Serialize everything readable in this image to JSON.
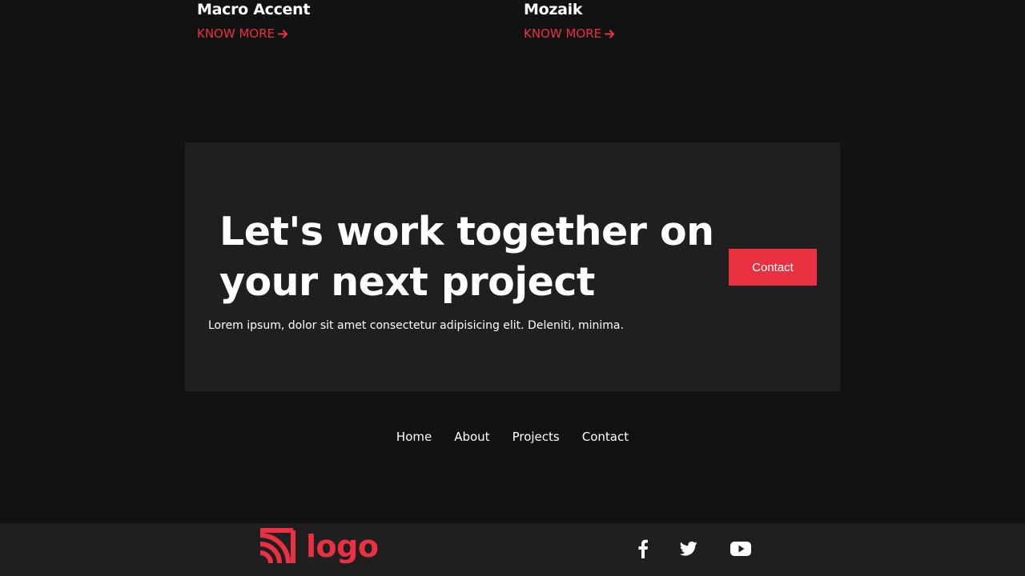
{
  "projects": [
    {
      "title": "Macro Accent",
      "link_label": "KNOW MORE"
    },
    {
      "title": "Mozaik",
      "link_label": "KNOW MORE"
    }
  ],
  "cta": {
    "title": "Let's work together on your next project",
    "text": "Lorem ipsum, dolor sit amet consectetur adipisicing elit. Deleniti, minima.",
    "button_label": "Contact"
  },
  "footer_nav": {
    "items": [
      "Home",
      "About",
      "Projects",
      "Contact"
    ]
  },
  "footer": {
    "logo_text": "logo",
    "social_icons": [
      "facebook-icon",
      "twitter-icon",
      "youtube-icon"
    ]
  },
  "colors": {
    "accent": "#ea3142",
    "background": "#121212",
    "panel": "#1f1f1f",
    "text": "#ffffff"
  }
}
